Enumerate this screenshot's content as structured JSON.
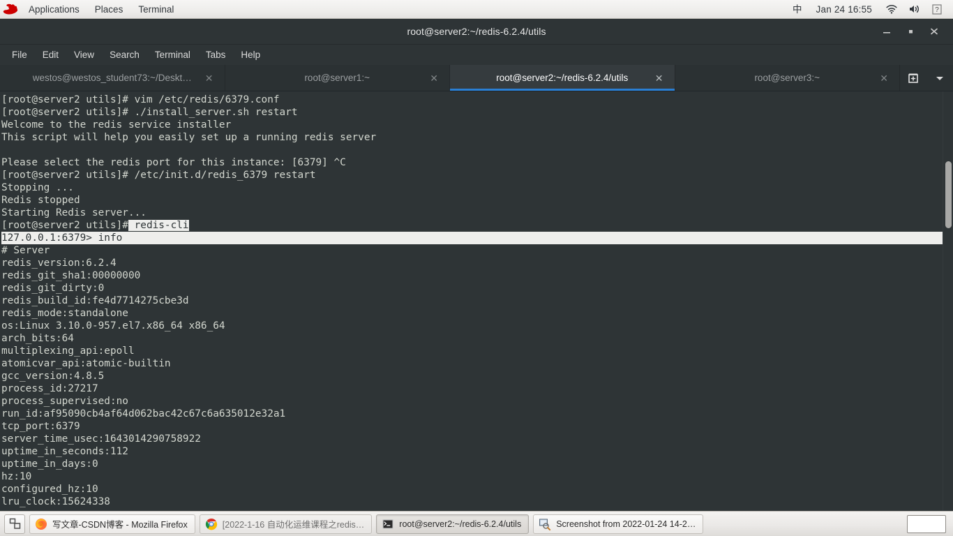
{
  "topbar": {
    "logo_icon": "redhat-logo-icon",
    "menus": [
      {
        "label": "Applications",
        "name": "applications-menu"
      },
      {
        "label": "Places",
        "name": "places-menu"
      },
      {
        "label": "Terminal",
        "name": "terminal-menu"
      }
    ],
    "ime_indicator": "中",
    "clock": "Jan 24  16:55",
    "indicators": [
      {
        "name": "network-wifi-icon"
      },
      {
        "name": "volume-icon"
      },
      {
        "name": "help-unknown-icon"
      }
    ]
  },
  "window": {
    "title": "root@server2:~/redis-6.2.4/utils",
    "controls": [
      {
        "name": "minimize-button",
        "glyph": "minimize"
      },
      {
        "name": "maximize-button",
        "glyph": "maximize"
      },
      {
        "name": "close-button",
        "glyph": "close"
      }
    ],
    "menubar": [
      "File",
      "Edit",
      "View",
      "Search",
      "Terminal",
      "Tabs",
      "Help"
    ]
  },
  "tabs": [
    {
      "label": "westos@westos_student73:~/Deskt…",
      "active": false,
      "name": "tab-westos-student73"
    },
    {
      "label": "root@server1:~",
      "active": false,
      "name": "tab-root-server1"
    },
    {
      "label": "root@server2:~/redis-6.2.4/utils",
      "active": true,
      "name": "tab-root-server2"
    },
    {
      "label": "root@server3:~",
      "active": false,
      "name": "tab-root-server3"
    }
  ],
  "tab_actions": [
    {
      "name": "new-tab-icon"
    },
    {
      "name": "tab-list-chevron-down-icon"
    }
  ],
  "terminal": {
    "accent_blue": "#2a7fd4",
    "background": "#2e3436",
    "foreground": "#d3d7cf",
    "selection_background": "#eeeeec",
    "selection_foreground": "#2e3436",
    "lines": [
      {
        "text": "[root@server2 utils]# vim /etc/redis/6379.conf",
        "sel": "none"
      },
      {
        "text": "[root@server2 utils]# ./install_server.sh restart",
        "sel": "none"
      },
      {
        "text": "Welcome to the redis service installer",
        "sel": "none"
      },
      {
        "text": "This script will help you easily set up a running redis server",
        "sel": "none"
      },
      {
        "text": "",
        "sel": "none"
      },
      {
        "text": "Please select the redis port for this instance: [6379] ^C",
        "sel": "none"
      },
      {
        "text": "[root@server2 utils]# /etc/init.d/redis_6379 restart",
        "sel": "none"
      },
      {
        "text": "Stopping ...",
        "sel": "none"
      },
      {
        "text": "Redis stopped",
        "sel": "none"
      },
      {
        "text": "Starting Redis server...",
        "sel": "none"
      },
      {
        "text": "[root@server2 utils]# redis-cli",
        "sel": "partial",
        "sel_start": 21
      },
      {
        "text": "127.0.0.1:6379> info",
        "sel": "full"
      },
      {
        "text": "# Server",
        "sel": "none"
      },
      {
        "text": "redis_version:6.2.4",
        "sel": "none"
      },
      {
        "text": "redis_git_sha1:00000000",
        "sel": "none"
      },
      {
        "text": "redis_git_dirty:0",
        "sel": "none"
      },
      {
        "text": "redis_build_id:fe4d7714275cbe3d",
        "sel": "none"
      },
      {
        "text": "redis_mode:standalone",
        "sel": "none"
      },
      {
        "text": "os:Linux 3.10.0-957.el7.x86_64 x86_64",
        "sel": "none"
      },
      {
        "text": "arch_bits:64",
        "sel": "none"
      },
      {
        "text": "multiplexing_api:epoll",
        "sel": "none"
      },
      {
        "text": "atomicvar_api:atomic-builtin",
        "sel": "none"
      },
      {
        "text": "gcc_version:4.8.5",
        "sel": "none"
      },
      {
        "text": "process_id:27217",
        "sel": "none"
      },
      {
        "text": "process_supervised:no",
        "sel": "none"
      },
      {
        "text": "run_id:af95090cb4af64d062bac42c67c6a635012e32a1",
        "sel": "none"
      },
      {
        "text": "tcp_port:6379",
        "sel": "none"
      },
      {
        "text": "server_time_usec:1643014290758922",
        "sel": "none"
      },
      {
        "text": "uptime_in_seconds:112",
        "sel": "none"
      },
      {
        "text": "uptime_in_days:0",
        "sel": "none"
      },
      {
        "text": "hz:10",
        "sel": "none"
      },
      {
        "text": "configured_hz:10",
        "sel": "none"
      },
      {
        "text": "lru_clock:15624338",
        "sel": "none"
      }
    ]
  },
  "taskbar": {
    "show_desktop_icon": "show-desktop-icon",
    "items": [
      {
        "label": "写文章-CSDN博客 - Mozilla Firefox",
        "icon": "firefox-icon",
        "state": "normal",
        "name": "task-firefox"
      },
      {
        "label": "[2022-1-16 自动化运维课程之redis…",
        "icon": "chrome-icon",
        "state": "inactive",
        "name": "task-chrome"
      },
      {
        "label": "root@server2:~/redis-6.2.4/utils",
        "icon": "terminal-icon",
        "state": "active",
        "name": "task-terminal"
      },
      {
        "label": "Screenshot from 2022-01-24 14-2…",
        "icon": "screenshot-icon",
        "state": "normal",
        "name": "task-screenshot"
      }
    ],
    "workspace_switcher": "workspace-switcher"
  }
}
